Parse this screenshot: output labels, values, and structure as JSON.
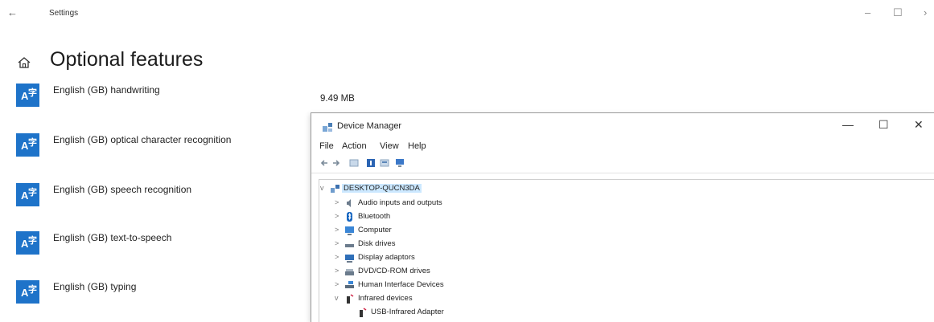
{
  "window": {
    "back_glyph": "←",
    "title": "Settings",
    "min_glyph": "–",
    "max_glyph": "☐",
    "close_glyph": "›"
  },
  "page": {
    "title": "Optional features"
  },
  "features": [
    {
      "label": "English (GB) handwriting",
      "icon": "language-font-icon"
    },
    {
      "label": "English (GB) optical character recognition",
      "icon": "language-font-icon"
    },
    {
      "label": "English (GB) speech recognition",
      "icon": "language-font-icon"
    },
    {
      "label": "English (GB) text-to-speech",
      "icon": "language-font-icon"
    },
    {
      "label": "English (GB) typing",
      "icon": "language-font-icon"
    }
  ],
  "first_feature_size": "9.49 MB",
  "device_manager": {
    "title": "Device Manager",
    "controls": {
      "minimize": "—",
      "maximize": "☐",
      "close": "✕"
    },
    "menu": [
      "File",
      "Action",
      "View",
      "Help"
    ],
    "root": {
      "label": "DESKTOP-QUCN3DA",
      "expander": "v"
    },
    "nodes": [
      {
        "label": "Audio inputs and outputs",
        "expander": ">",
        "icon": "speaker-icon"
      },
      {
        "label": "Bluetooth",
        "expander": ">",
        "icon": "bluetooth-icon"
      },
      {
        "label": "Computer",
        "expander": ">",
        "icon": "computer-icon"
      },
      {
        "label": "Disk drives",
        "expander": ">",
        "icon": "disk-drive-icon"
      },
      {
        "label": "Display adaptors",
        "expander": ">",
        "icon": "display-adapter-icon"
      },
      {
        "label": "DVD/CD-ROM drives",
        "expander": ">",
        "icon": "dvd-drive-icon"
      },
      {
        "label": "Human Interface Devices",
        "expander": ">",
        "icon": "hid-icon"
      },
      {
        "label": "Infrared devices",
        "expander": "v",
        "icon": "infrared-icon"
      },
      {
        "label": "USB-Infrared Adapter",
        "expander": "",
        "icon": "infrared-icon"
      }
    ]
  },
  "colors": {
    "accent": "#1e73c9",
    "selection": "#cce8ff"
  }
}
